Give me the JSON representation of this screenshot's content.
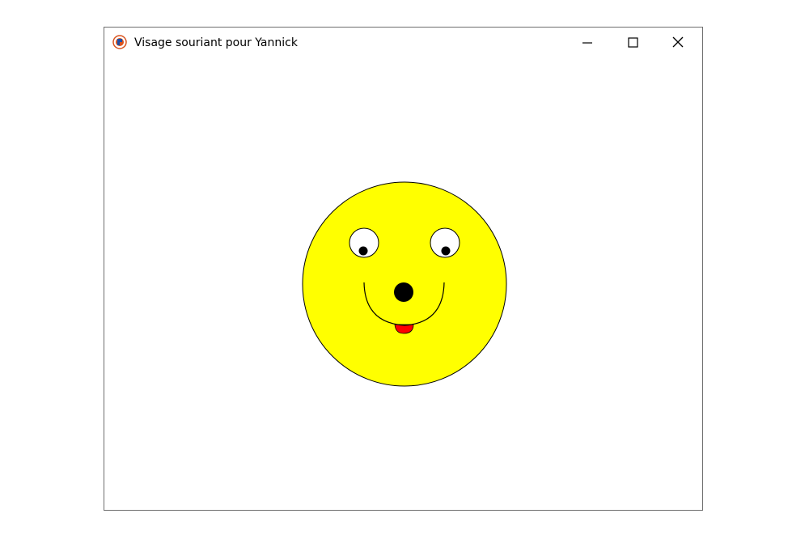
{
  "window": {
    "title": "Visage souriant pour Yannick",
    "icon": "python-turtle-app-icon",
    "controls": {
      "minimize": "minimize-icon",
      "maximize": "maximize-icon",
      "close": "close-icon"
    }
  },
  "drawing": {
    "face_fill": "#ffff00",
    "outline_color": "#000000",
    "eye_fill": "#ffffff",
    "pupil_color": "#000000",
    "nose_color": "#000000",
    "tongue_color": "#ff0000",
    "background": "#ffffff"
  }
}
